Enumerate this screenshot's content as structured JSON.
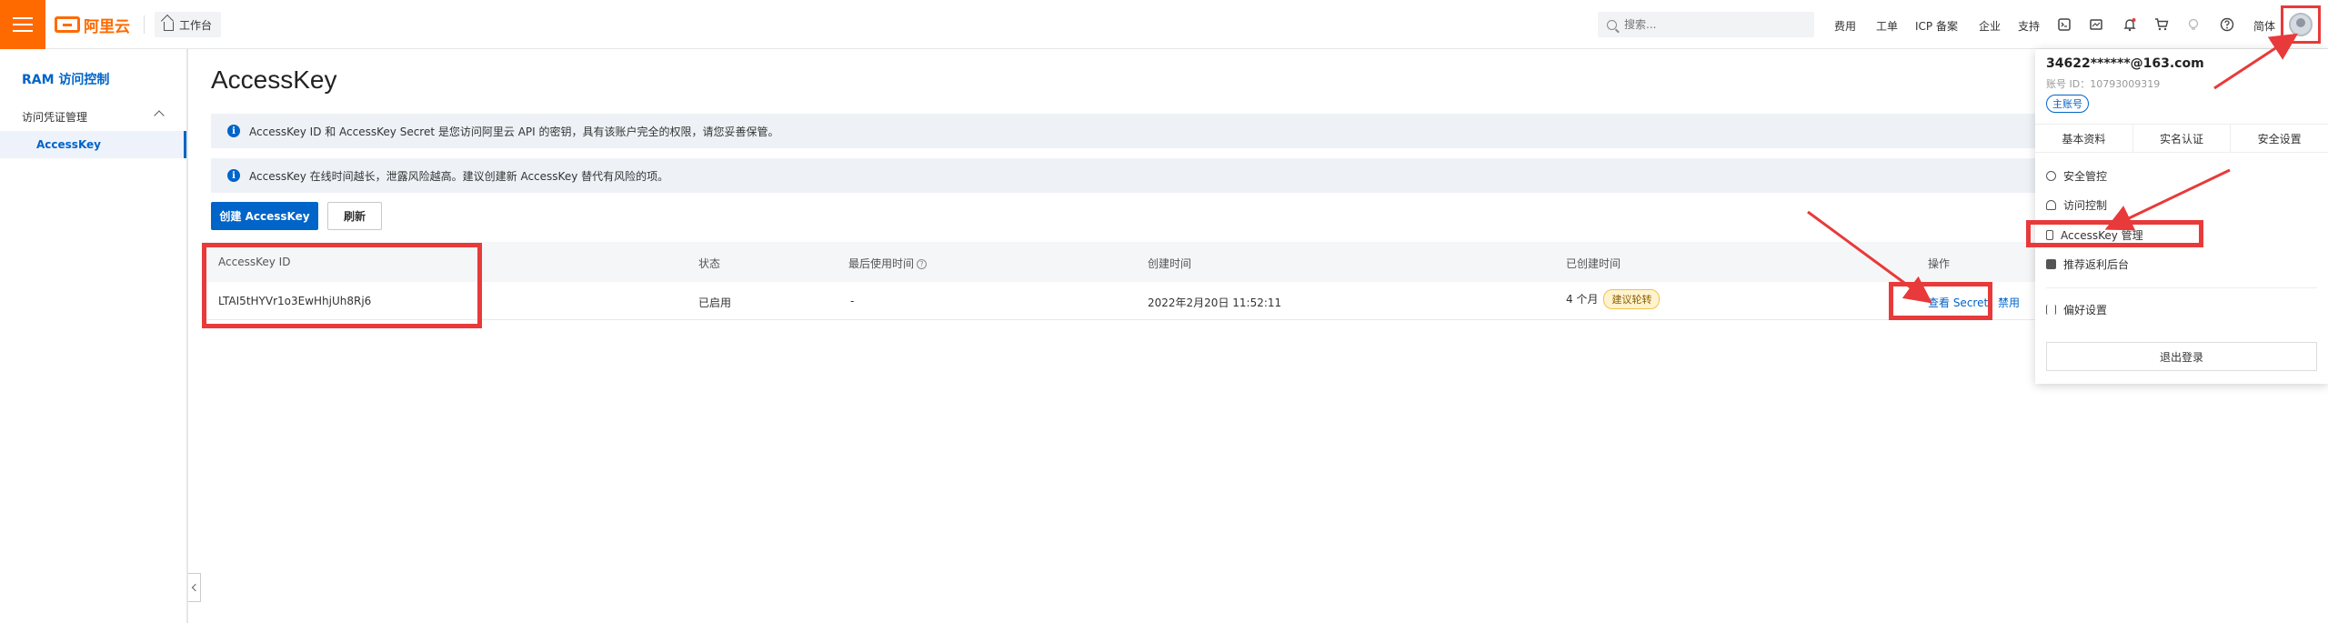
{
  "header": {
    "logo_text": "阿里云",
    "workbench_label": "工作台",
    "search_placeholder": "搜索...",
    "links": [
      "费用",
      "工单",
      "ICP 备案",
      "企业",
      "支持"
    ],
    "lang_label": "简体",
    "icons": [
      "terminal-icon",
      "message-icon",
      "bell-icon",
      "bulb-icon",
      "cart-icon",
      "help-icon"
    ]
  },
  "sidebar": {
    "title": "RAM 访问控制",
    "group_label": "访问凭证管理",
    "active_item": "AccessKey"
  },
  "main": {
    "page_title": "AccessKey",
    "notice_1": "AccessKey ID 和 AccessKey Secret 是您访问阿里云 API 的密钥，具有该账户完全的权限，请您妥善保管。",
    "notice_2": "AccessKey 在线时间越长，泄露风险越高。建议创建新 AccessKey 替代有风险的项。",
    "create_button": "创建 AccessKey",
    "refresh_button": "刷新"
  },
  "table": {
    "columns": [
      "AccessKey ID",
      "状态",
      "最后使用时间",
      "创建时间",
      "已创建时间",
      "操作"
    ],
    "rows": [
      {
        "access_key_id": "LTAI5tHYVr1o3EwHhjUh8Rj6",
        "status": "已启用",
        "last_used": "-",
        "created_at": "2022年2月20日 11:52:11",
        "age": "4 个月",
        "age_badge": "建议轮转",
        "action_view": "查看 Secret",
        "action_disable": "禁用"
      }
    ]
  },
  "dropdown": {
    "email": "34622******@163.com",
    "account_id": "账号 ID：10793009319",
    "badge": "主账号",
    "tabs": [
      "基本资料",
      "实名认证",
      "安全设置"
    ],
    "items": [
      "安全管控",
      "访问控制",
      "AccessKey 管理",
      "推荐返利后台"
    ],
    "preferences": "偏好设置",
    "logout": "退出登录"
  },
  "colors": {
    "brand": "#ff6a00",
    "primary": "#0064c8",
    "annotation": "#e83a3a"
  }
}
